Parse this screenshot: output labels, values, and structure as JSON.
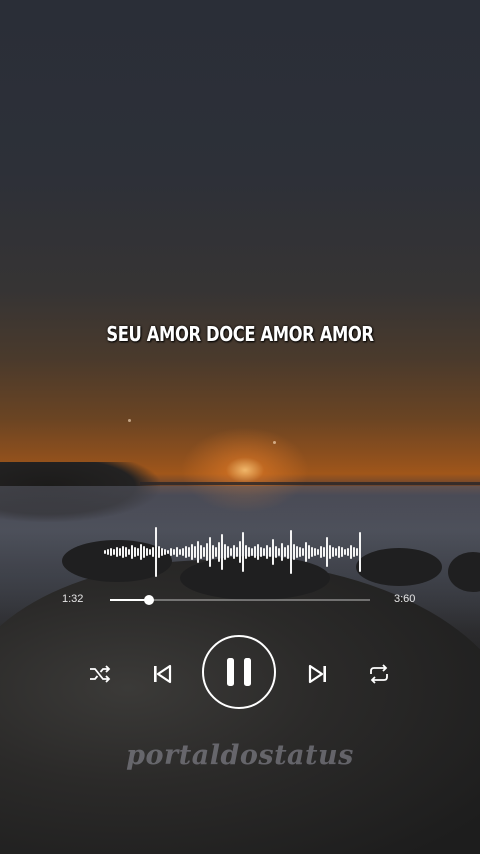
{
  "lyric": "SEU AMOR DOCE AMOR AMOR",
  "player": {
    "current_time": "1:32",
    "total_time": "3:60",
    "progress": 0.15,
    "is_playing": true,
    "controls": {
      "shuffle": "shuffle-icon",
      "previous": "skip-previous-icon",
      "play_pause": "pause-icon",
      "next": "skip-next-icon",
      "repeat": "repeat-icon"
    }
  },
  "watermark": "portaldostatus",
  "colors": {
    "ui": "#ffffff",
    "watermark": "#9696a0"
  }
}
